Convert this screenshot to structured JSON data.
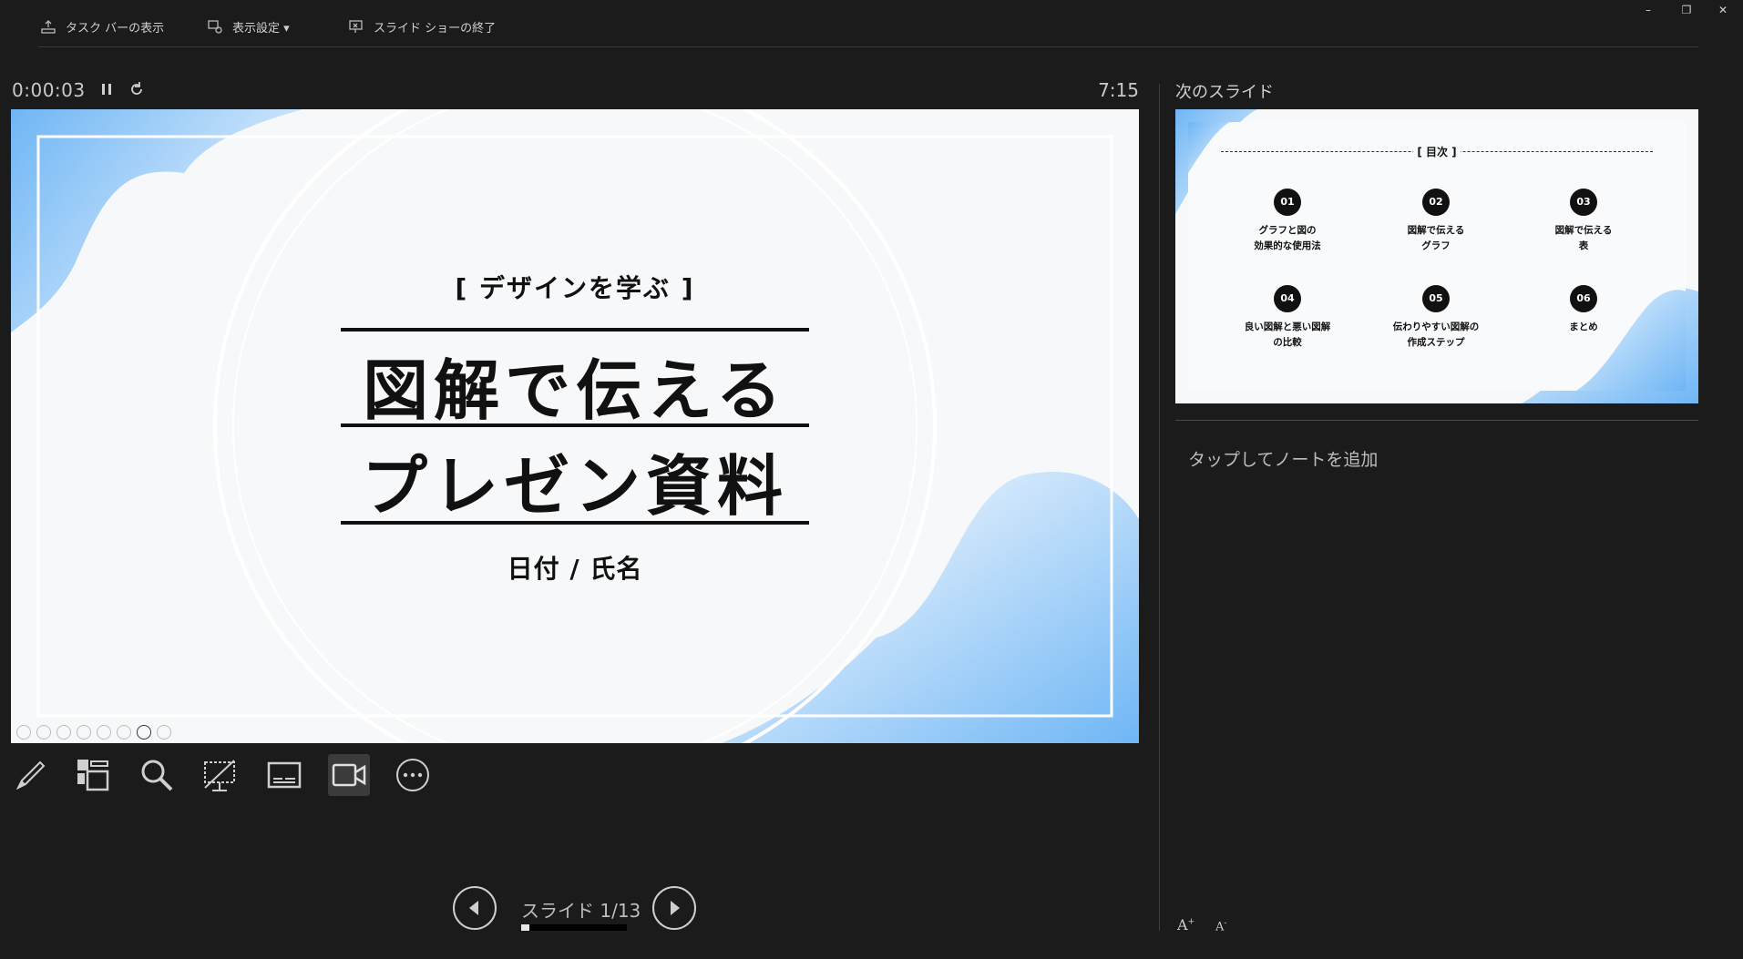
{
  "toolbar": {
    "taskbar": "タスク バーの表示",
    "display": "表示設定 ▾",
    "end_show": "スライド ショーの終了"
  },
  "window": {
    "minimize": "–",
    "restore": "❐",
    "close": "✕"
  },
  "timer": {
    "elapsed": "0:00:03",
    "clock": "7:15"
  },
  "slide": {
    "subtitle": "[ デザインを学ぶ ]",
    "title_line1": "図解で伝える",
    "title_line2": "プレゼン資料",
    "date_name": "日付 / 氏名"
  },
  "tools": [
    "pen-icon",
    "see-all-slides-icon",
    "zoom-icon",
    "black-screen-icon",
    "subtitles-icon",
    "camera-icon",
    "more-options-icon"
  ],
  "navigation": {
    "label": "スライド 1/13",
    "current": 1,
    "total": 13
  },
  "next_slide": {
    "label": "次のスライド",
    "toc_title": "[ 目次 ]",
    "items": [
      {
        "num": "01",
        "label": "グラフと図の\n効果的な使用法"
      },
      {
        "num": "02",
        "label": "図解で伝える\nグラフ"
      },
      {
        "num": "03",
        "label": "図解で伝える\n表"
      },
      {
        "num": "04",
        "label": "良い図解と悪い図解\nの比較"
      },
      {
        "num": "05",
        "label": "伝わりやすい図解の\n作成ステップ"
      },
      {
        "num": "06",
        "label": "まとめ"
      }
    ]
  },
  "notes": {
    "placeholder": "タップしてノートを追加"
  },
  "font_controls": {
    "increase": "A",
    "decrease": "A"
  },
  "colors": {
    "accent_blue": "#6fb6f5",
    "background": "#1b1b1b"
  }
}
